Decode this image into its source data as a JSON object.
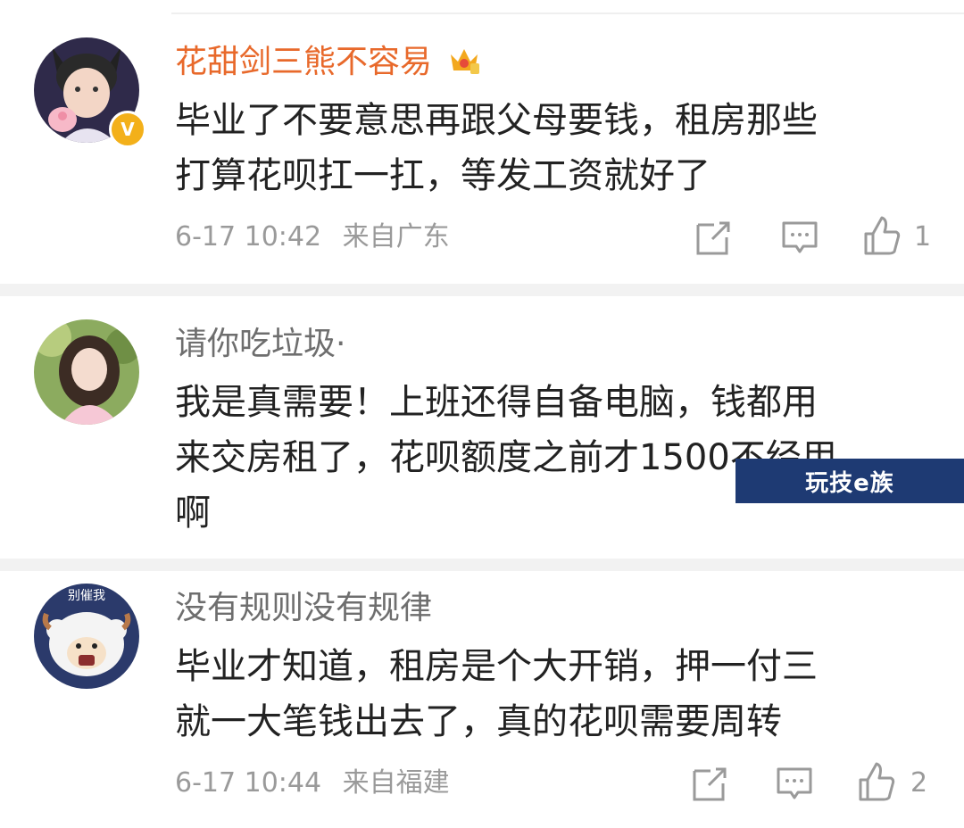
{
  "comments": [
    {
      "username": "花甜剑三熊不容易",
      "text_lines": [
        "毕业了不要意思再跟父母要钱，租房那些",
        "打算花呗扛一扛，等发工资就好了"
      ],
      "date": "6-17 10:42",
      "location": "来自广东",
      "likes": "1",
      "username_color": "#e8692b",
      "badge_icon": "crown-vip-icon",
      "verified_label": "V"
    },
    {
      "username": "请你吃垃圾·",
      "text_lines": [
        "我是真需要！上班还得自备电脑，钱都用",
        "来交房租了，花呗额度之前才1500不经用",
        "啊"
      ]
    },
    {
      "username": "没有规则没有规律",
      "text_lines": [
        "毕业才知道，租房是个大开销，押一付三",
        "就一大笔钱出去了，真的花呗需要周转"
      ],
      "date": "6-17 10:44",
      "location": "来自福建",
      "likes": "2",
      "avatar_caption": "别催我"
    }
  ],
  "watermark": "玩技e族"
}
